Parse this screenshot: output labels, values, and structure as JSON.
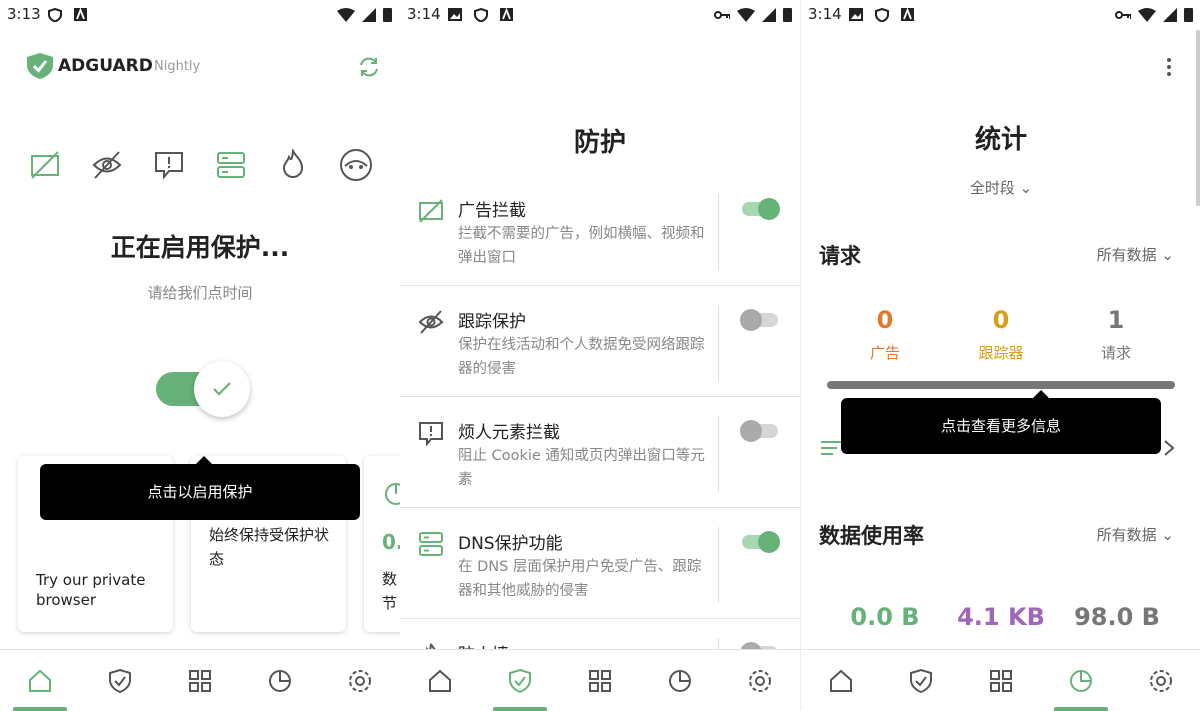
{
  "s1": {
    "time": "3:13",
    "brand": "ADGUARD",
    "brand_sub": "Nightly",
    "status_title": "正在启用保护...",
    "status_sub": "请给我们点时间",
    "tooltip": "点击以启用保护",
    "card1_text": "Try our private browser",
    "card2_text": "始终保持受保护状态",
    "card3_num": "0.",
    "card3_l1": "数",
    "card3_l2": "节"
  },
  "s2": {
    "time": "3:14",
    "title": "防护",
    "rows": [
      {
        "title": "广告拦截",
        "desc": "拦截不需要的广告，例如横幅、视频和弹出窗口",
        "on": true,
        "icon": "ad-block-icon"
      },
      {
        "title": "跟踪保护",
        "desc": "保护在线活动和个人数据免受网络跟踪器的侵害",
        "on": false,
        "icon": "eye-slash-icon"
      },
      {
        "title": "烦人元素拦截",
        "desc": "阻止 Cookie 通知或页内弹出窗口等元素",
        "on": false,
        "icon": "message-alert-icon"
      },
      {
        "title": "DNS保护功能",
        "desc": "在 DNS 层面保护用户免受广告、跟踪器和其他威胁的侵害",
        "on": true,
        "icon": "dns-server-icon"
      },
      {
        "title": "防火墙",
        "desc": "",
        "on": false,
        "icon": "firewall-icon"
      }
    ]
  },
  "s3": {
    "time": "3:14",
    "title": "统计",
    "period": "全时段",
    "req_title": "请求",
    "all_data": "所有数据",
    "ads_val": "0",
    "ads_label": "广告",
    "trk_val": "0",
    "trk_label": "跟踪器",
    "req_val": "1",
    "req_label": "请求",
    "tooltip": "点击查看更多信息",
    "usage_title": "数据使用率",
    "usage_all": "所有数据",
    "saved": "0.0 B",
    "uploaded": "4.1 KB",
    "downloaded": "98.0 B"
  },
  "colors": {
    "green": "#67b279",
    "orange": "#e07a2f",
    "amber": "#d4a017",
    "purple": "#a067b8",
    "gray": "#777"
  }
}
